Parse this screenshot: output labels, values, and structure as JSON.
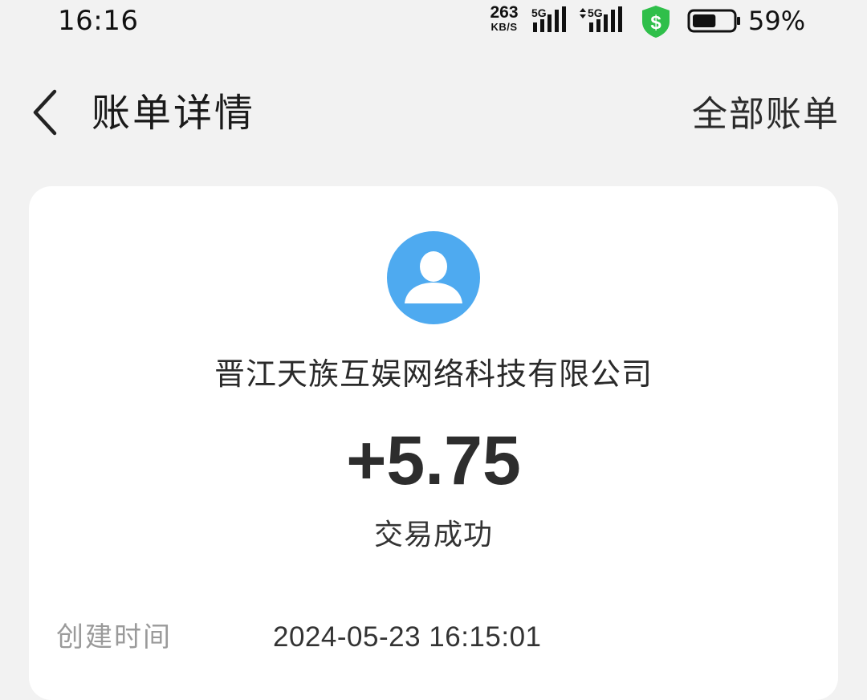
{
  "status_bar": {
    "time": "16:16",
    "net_speed_value": "263",
    "net_speed_unit": "KB/S",
    "signal_1_label": "5G",
    "signal_2_label": "5G",
    "shield_symbol": "$",
    "battery_percent_text": "59%",
    "battery_level": 0.59,
    "shield_color": "#2fbf4a",
    "icons": [
      "signal-5g-icon",
      "signal-5g-data-icon",
      "shield-dollar-icon",
      "battery-icon"
    ]
  },
  "nav": {
    "back_icon": "chevron-left-icon",
    "title": "账单详情",
    "all_bills_label": "全部账单"
  },
  "bill": {
    "avatar_icon": "user-avatar-icon",
    "avatar_color": "#4eaaf0",
    "payee": "晋江天族互娱网络科技有限公司",
    "amount": "+5.75",
    "status": "交易成功",
    "details": [
      {
        "label": "创建时间",
        "value": "2024-05-23 16:15:01"
      }
    ]
  }
}
